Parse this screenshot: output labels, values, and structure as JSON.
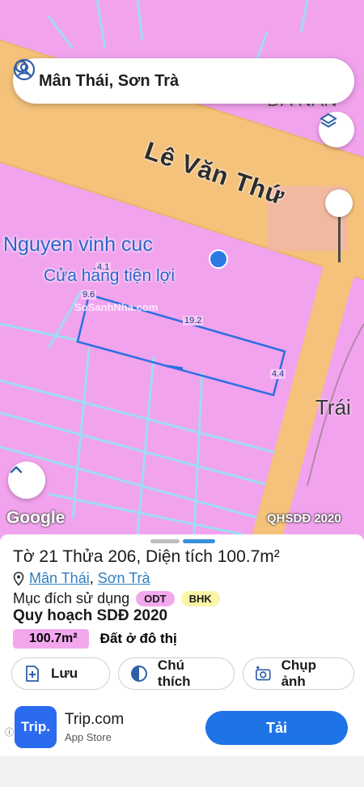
{
  "search": {
    "query": "Mân Thái, Sơn Trà"
  },
  "map": {
    "street_name": "Lê Văn Thứ",
    "poi_name": "Nguyen vinh cuc",
    "poi_subtitle": "Cửa hàng tiện lợi",
    "area_label_right": "Trái",
    "area_label_top": "ĐÀ NẴN",
    "google_logo": "Google",
    "overlay_label": "QHSDĐ 2020",
    "dimensions": {
      "top": "4.1",
      "left": "9.6",
      "length": "19.2",
      "right": "4.4"
    },
    "land_color": "#f2a3ee",
    "road_color": "#f4c27a"
  },
  "sheet": {
    "title": "Tờ 21 Thửa 206, Diện tích 100.7m²",
    "ward": "Mân Thái",
    "district": "Sơn Trà",
    "purpose_label": "Mục đích sử dụng",
    "purpose_tags": [
      "ODT",
      "BHK"
    ],
    "plan_title": "Quy hoạch SDĐ 2020",
    "area_value": "100.7m²",
    "area_type": "Đất ở đô thị",
    "actions": {
      "save": "Lưu",
      "legend": "Chú thích",
      "capture": "Chụp ảnh"
    }
  },
  "ad": {
    "logo_text": "Trip.",
    "app_name": "Trip.com",
    "store": "App Store",
    "cta": "Tải",
    "info_icon": "ⓘ"
  },
  "colors": {
    "accent": "#1e74e6",
    "link": "#2e7fc2",
    "odt": "#f3a8ee",
    "bhk": "#fbf5a8"
  }
}
